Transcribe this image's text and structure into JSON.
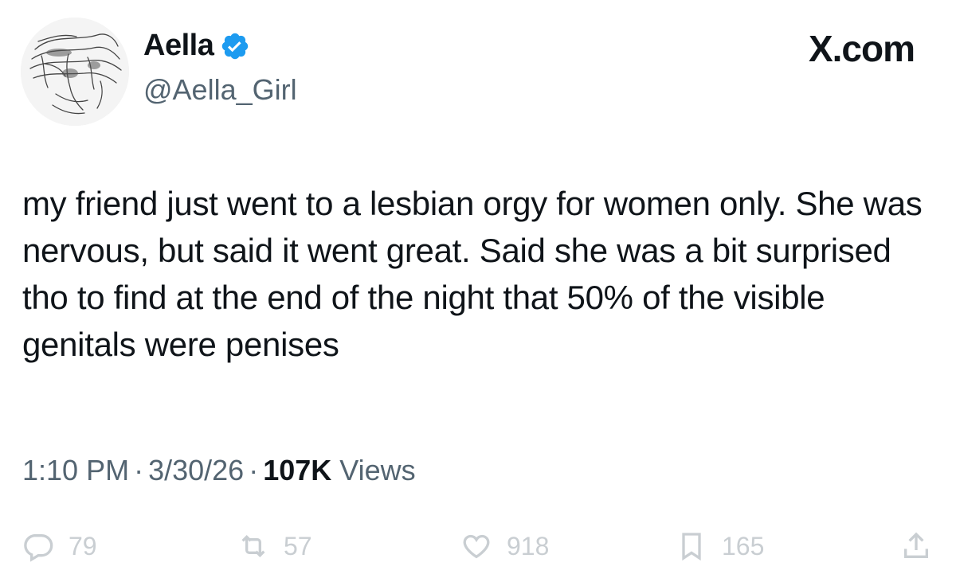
{
  "author": {
    "display_name": "Aella",
    "handle": "@Aella_Girl",
    "verified_icon": "verified-badge-icon",
    "verified_color": "#1d9bf0"
  },
  "brand": {
    "label": "X.com"
  },
  "tweet": {
    "text": "my friend just went to a lesbian orgy for women only. She was nervous, but said it went great. Said she was a bit surprised tho to find at the end of the night that 50% of the visible genitals were penises"
  },
  "meta": {
    "time": "1:10 PM",
    "separator": "·",
    "date": "3/30/26",
    "views_count": "107K",
    "views_label": "Views"
  },
  "actions": {
    "replies": "79",
    "reposts": "57",
    "likes": "918",
    "bookmarks": "165"
  },
  "colors": {
    "text": "#0f1419",
    "secondary": "#536471",
    "faded": "#c9ced2"
  }
}
